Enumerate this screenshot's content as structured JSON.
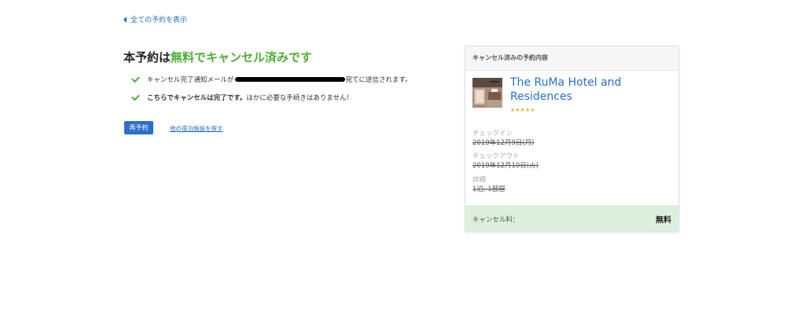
{
  "back_link": {
    "label": "全ての予約を表示"
  },
  "title": {
    "prefix": "本予約は",
    "highlight": "無料でキャンセル済みです"
  },
  "notices": [
    {
      "before": "キャンセル完了通知メールが",
      "after": "宛てに送信されます。"
    },
    {
      "strong": "こちらでキャンセルは完了です。",
      "rest": "ほかに必要な手続きはありません！"
    }
  ],
  "actions": {
    "rebook_label": "再予約",
    "other_link_label": "他の宿泊施設を探す"
  },
  "card": {
    "header": "キャンセル済みの予約内容",
    "hotel_name": "The RuMa Hotel and Residences",
    "stars": "★★★★★",
    "checkin_label": "チェックイン",
    "checkin_value": "2019年12月9日(月)",
    "checkout_label": "チェックアウト",
    "checkout_value": "2019年12月10日(火)",
    "details_label": "詳細",
    "details_value": "1泊, 1部屋",
    "fee_label": "キャンセル料：",
    "fee_value": "無料"
  },
  "colors": {
    "accent_green": "#4caf34",
    "link_blue": "#1e6fc1",
    "button_blue": "#2a6fc9",
    "fee_bg": "#dcefdc"
  }
}
